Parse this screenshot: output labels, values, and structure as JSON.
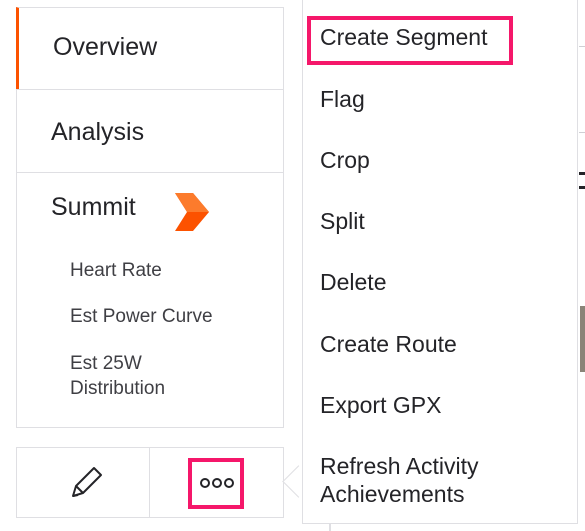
{
  "nav": {
    "overview": "Overview",
    "analysis": "Analysis",
    "summit": {
      "label": "Summit",
      "items": [
        "Heart Rate",
        "Est Power Curve",
        "Est 25W Distribution"
      ]
    },
    "active_item": "Overview"
  },
  "actions": {
    "edit_icon": "pencil-icon",
    "more_icon": "more-horizontal-icon"
  },
  "menu": {
    "items": [
      "Create Segment",
      "Flag",
      "Crop",
      "Split",
      "Delete",
      "Create Route",
      "Export GPX",
      "Refresh Activity Achievements"
    ],
    "highlighted": "Create Segment"
  },
  "colors": {
    "accent": "#fc5200",
    "highlight": "#f5176a",
    "border": "#dfdfe3",
    "text": "#242428"
  }
}
